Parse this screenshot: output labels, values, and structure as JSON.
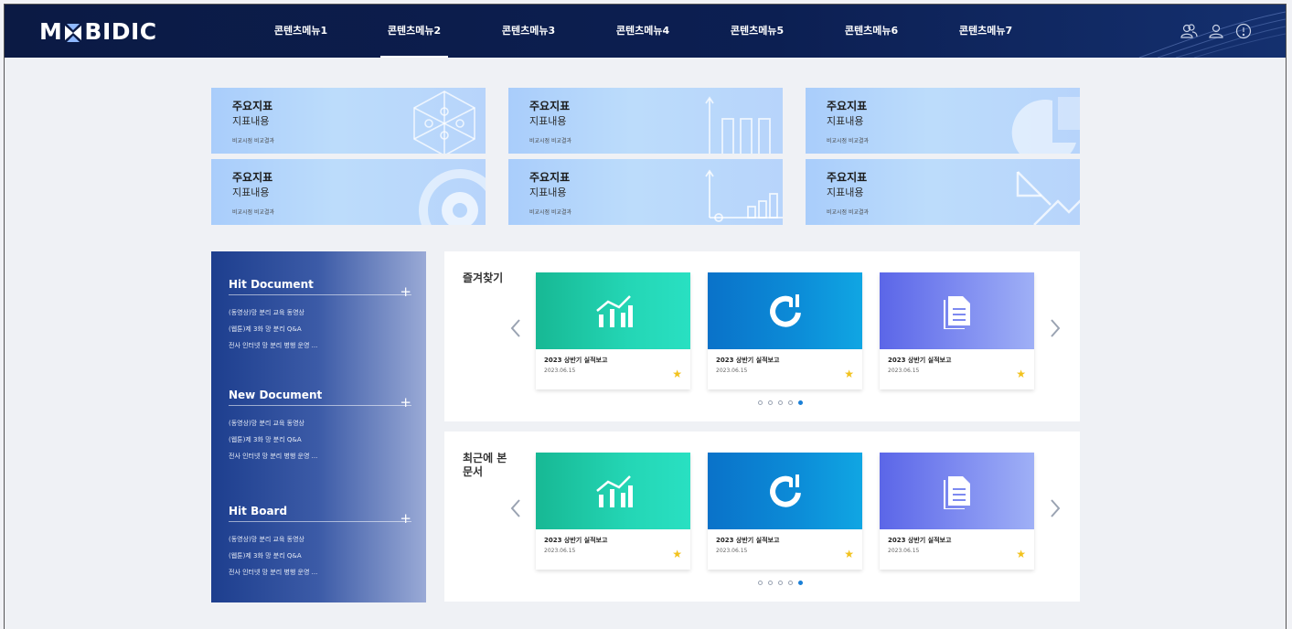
{
  "brand": {
    "logo_left": "M",
    "logo_right": "BIDIC"
  },
  "nav": [
    {
      "label": "콘텐츠메뉴1"
    },
    {
      "label": "콘텐츠메뉴2",
      "active": true
    },
    {
      "label": "콘텐츠메뉴3"
    },
    {
      "label": "콘텐츠메뉴4"
    },
    {
      "label": "콘텐츠메뉴5"
    },
    {
      "label": "콘텐츠메뉴6"
    },
    {
      "label": "콘텐츠메뉴7"
    }
  ],
  "header_icons": [
    "users-icon",
    "user-icon",
    "info-icon"
  ],
  "kpis": [
    {
      "title": "주요지표",
      "subtitle": "지표내용",
      "note": "비교시점 비교결과",
      "icon": "network-icon"
    },
    {
      "title": "주요지표",
      "subtitle": "지표내용",
      "note": "비교시점 비교결과",
      "icon": "bar-growth-icon"
    },
    {
      "title": "주요지표",
      "subtitle": "지표내용",
      "note": "비교시점 비교결과",
      "icon": "pie-icon"
    },
    {
      "title": "주요지표",
      "subtitle": "지표내용",
      "note": "비교시점 비교결과",
      "icon": "gear-icon"
    },
    {
      "title": "주요지표",
      "subtitle": "지표내용",
      "note": "비교시점 비교결과",
      "icon": "axis-chart-icon"
    },
    {
      "title": "주요지표",
      "subtitle": "지표내용",
      "note": "비교시점 비교결과",
      "icon": "arrows-icon"
    }
  ],
  "left_panel": {
    "sections": [
      {
        "title": "Hit Document",
        "items": [
          "(동영상)망 분리 교육 동영상",
          "(웹툰)제 3화 망 분리 Q&A",
          "전사 인터넷 망 분리 병행 운영 ..."
        ]
      },
      {
        "title": "New Document",
        "items": [
          "(동영상)망 분리 교육 동영상",
          "(웹툰)제 3화 망 분리 Q&A",
          "전사 인터넷 망 분리 병행 운영 ..."
        ]
      },
      {
        "title": "Hit Board",
        "items": [
          "(동영상)망 분리 교육 동영상",
          "(웹툰)제 3화 망 분리 Q&A",
          "전사 인터넷 망 분리 병행 운영 ..."
        ]
      }
    ]
  },
  "favorites": {
    "title": "즐겨찾기",
    "cards": [
      {
        "title": "2023 상반기 실적보고",
        "date": "2023.06.15",
        "icon": "growth-chart-icon"
      },
      {
        "title": "2023 상반기 실적보고",
        "date": "2023.06.15",
        "icon": "power-bars-icon"
      },
      {
        "title": "2023 상반기 실적보고",
        "date": "2023.06.15",
        "icon": "document-icon"
      }
    ],
    "dots": 5,
    "active_dot": 5
  },
  "recent": {
    "title": "최근에 본 문서",
    "cards": [
      {
        "title": "2023 상반기 실적보고",
        "date": "2023.06.15",
        "icon": "growth-chart-icon"
      },
      {
        "title": "2023 상반기 실적보고",
        "date": "2023.06.15",
        "icon": "power-bars-icon"
      },
      {
        "title": "2023 상반기 실적보고",
        "date": "2023.06.15",
        "icon": "document-icon"
      }
    ],
    "dots": 5,
    "active_dot": 5
  },
  "colors": {
    "header": "#0c1f52",
    "star": "#f2c21d",
    "dot_active": "#1a7fd6"
  }
}
